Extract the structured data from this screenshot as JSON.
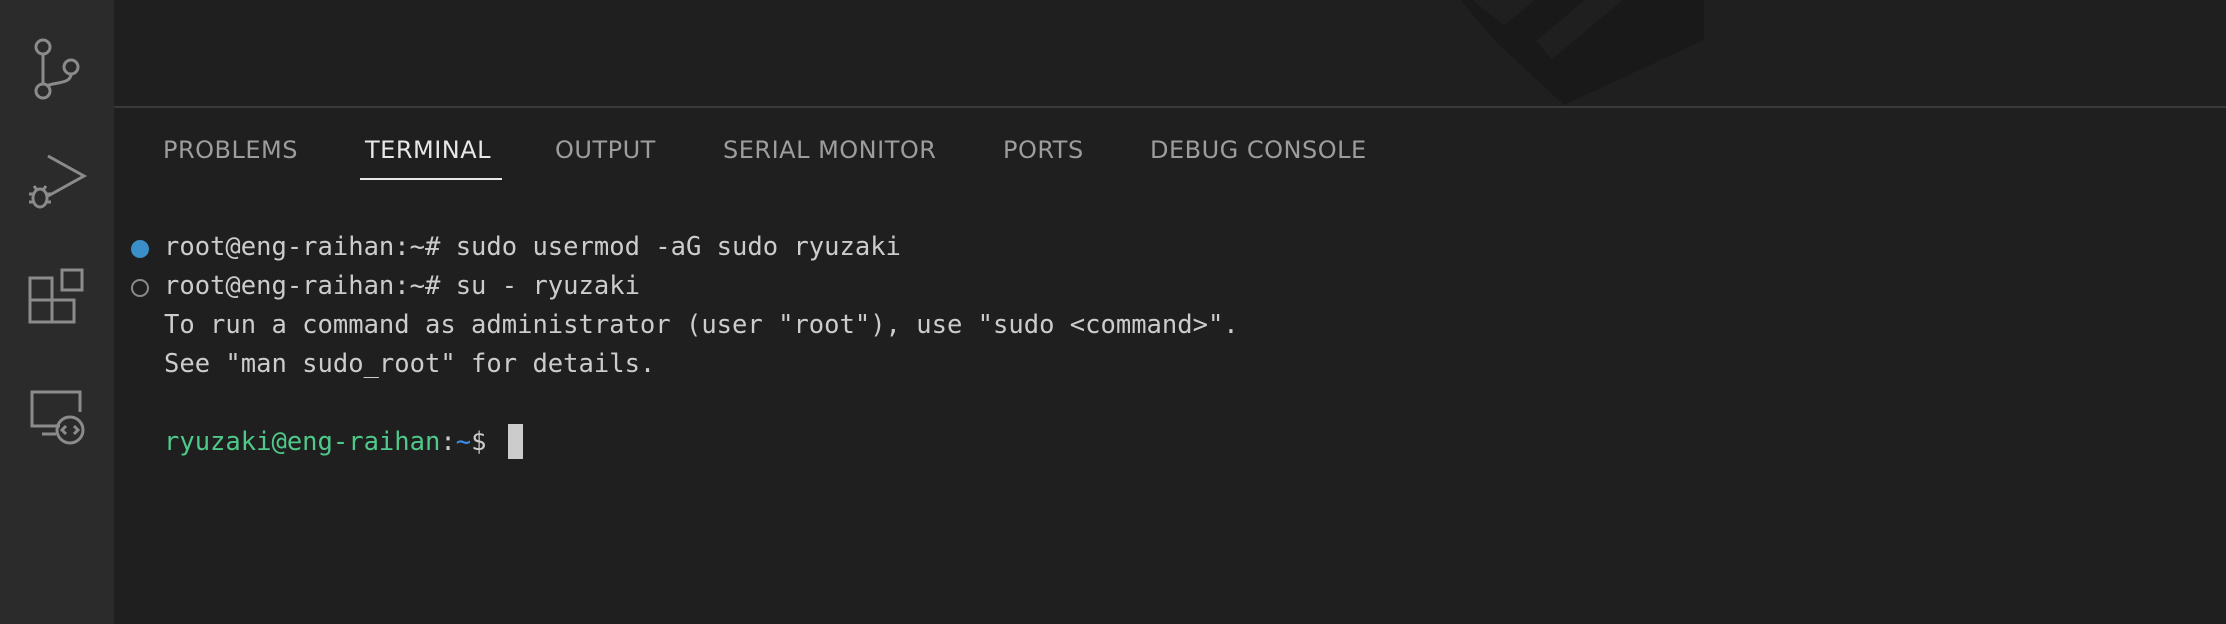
{
  "activity_bar": {
    "items": [
      {
        "name": "source-control-icon"
      },
      {
        "name": "run-debug-icon"
      },
      {
        "name": "extensions-icon"
      },
      {
        "name": "remote-explorer-icon"
      }
    ]
  },
  "panel": {
    "tabs": [
      {
        "label": "PROBLEMS",
        "active": false
      },
      {
        "label": "TERMINAL",
        "active": true
      },
      {
        "label": "OUTPUT",
        "active": false
      },
      {
        "label": "SERIAL MONITOR",
        "active": false
      },
      {
        "label": "PORTS",
        "active": false
      },
      {
        "label": "DEBUG CONSOLE",
        "active": false
      }
    ]
  },
  "terminal": {
    "lines": [
      {
        "decoration": "success",
        "text": "root@eng-raihan:~# sudo usermod -aG sudo ryuzaki"
      },
      {
        "decoration": "default",
        "text": "root@eng-raihan:~# su - ryuzaki"
      },
      {
        "decoration": "none",
        "text": "To run a command as administrator (user \"root\"), use \"sudo <command>\"."
      },
      {
        "decoration": "none",
        "text": "See \"man sudo_root\" for details."
      }
    ],
    "prompt": {
      "user_host": "ryuzaki@eng-raihan",
      "separator": ":",
      "path": "~",
      "symbol": "$ "
    }
  },
  "colors": {
    "background": "#1f1f1f",
    "activity_bar": "#2b2b2b",
    "prompt_user": "#4ec98a",
    "prompt_path": "#3b8eea",
    "success_decoration": "#3a8fc9"
  }
}
